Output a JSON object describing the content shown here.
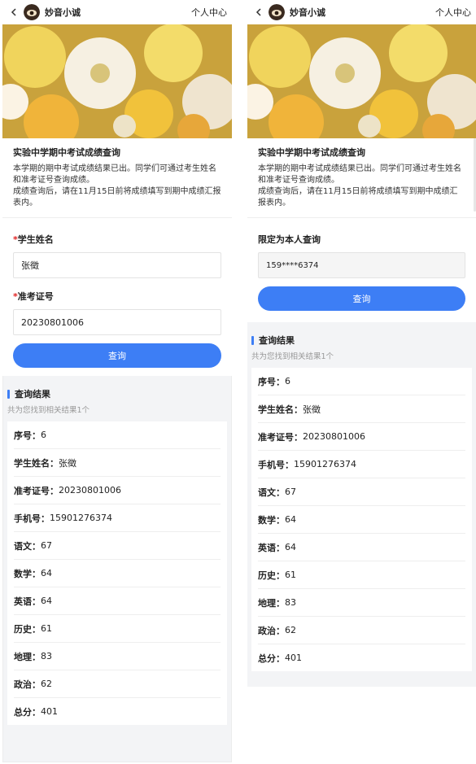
{
  "app": {
    "name": "妙音小诚",
    "user_center": "个人中心"
  },
  "intro": {
    "title": "实验中学期中考试成绩查询",
    "text_1": "本学期的期中考试成绩结果已出。同学们可通过考生姓名和准考证号查询成绩。",
    "text_2": "成绩查询后，请在11月15日前将成绩填写到期中成绩汇报表内。"
  },
  "left_form": {
    "name_label": "学生姓名",
    "name_value": "张徵",
    "id_label": "准考证号",
    "id_value": "20230801006",
    "required_mark": "*",
    "query_button": "查询"
  },
  "right_form": {
    "self_label": "限定为本人查询",
    "phone_value": "159****6374",
    "query_button": "查询"
  },
  "results": {
    "title": "查询结果",
    "count_text": "共为您找到相关结果1个",
    "rows": [
      {
        "key": "序号：",
        "value": "6"
      },
      {
        "key": "学生姓名：",
        "value": "张徵"
      },
      {
        "key": "准考证号：",
        "value": "20230801006"
      },
      {
        "key": "手机号：",
        "value": "15901276374"
      },
      {
        "key": "语文：",
        "value": "67"
      },
      {
        "key": "数学：",
        "value": "64"
      },
      {
        "key": "英语：",
        "value": "64"
      },
      {
        "key": "历史：",
        "value": "61"
      },
      {
        "key": "地理：",
        "value": "83"
      },
      {
        "key": "政治：",
        "value": "62"
      },
      {
        "key": "总分：",
        "value": "401"
      }
    ]
  },
  "colors": {
    "accent": "#3d7ef5",
    "required": "#e02020",
    "result_bg": "#f3f4f6"
  },
  "icons": {
    "back": "chevron-left-icon",
    "logo": "avatar-logo-icon",
    "banner": "flower-banner-image"
  }
}
